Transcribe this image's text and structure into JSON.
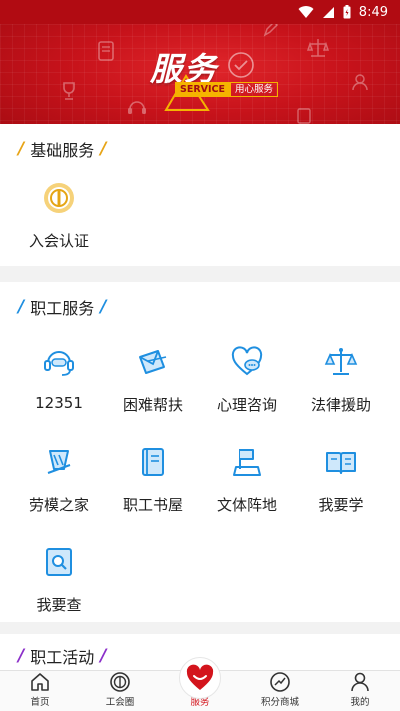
{
  "status_bar": {
    "time": "8:49"
  },
  "banner": {
    "title": "服务",
    "tag_en": "SERVICE",
    "tag_cn": "用心服务"
  },
  "sections": {
    "basic": {
      "title": "基础服务",
      "items": [
        {
          "label": "入会认证",
          "icon": "badge-icon"
        }
      ]
    },
    "worker": {
      "title": "职工服务",
      "items": [
        {
          "label": "12351",
          "icon": "headset-icon"
        },
        {
          "label": "困难帮扶",
          "icon": "envelope-icon"
        },
        {
          "label": "心理咨询",
          "icon": "heart-chat-icon"
        },
        {
          "label": "法律援助",
          "icon": "scales-icon"
        },
        {
          "label": "劳模之家",
          "icon": "medal-icon"
        },
        {
          "label": "职工书屋",
          "icon": "book-icon"
        },
        {
          "label": "文体阵地",
          "icon": "flag-icon"
        },
        {
          "label": "我要学",
          "icon": "open-book-icon"
        },
        {
          "label": "我要查",
          "icon": "search-icon"
        }
      ]
    },
    "activity": {
      "title": "职工活动"
    }
  },
  "bottom_nav": [
    {
      "label": "首页",
      "icon": "home-icon"
    },
    {
      "label": "工会圈",
      "icon": "union-circle-icon"
    },
    {
      "label": "服务",
      "icon": "heart-icon",
      "active": true
    },
    {
      "label": "积分商城",
      "icon": "mall-icon"
    },
    {
      "label": "我的",
      "icon": "profile-icon"
    }
  ],
  "colors": {
    "brand_red": "#c8131b",
    "icon_blue": "#1f8fe0",
    "accent_yellow": "#e7a417",
    "accent_purple": "#8b2fc9"
  }
}
